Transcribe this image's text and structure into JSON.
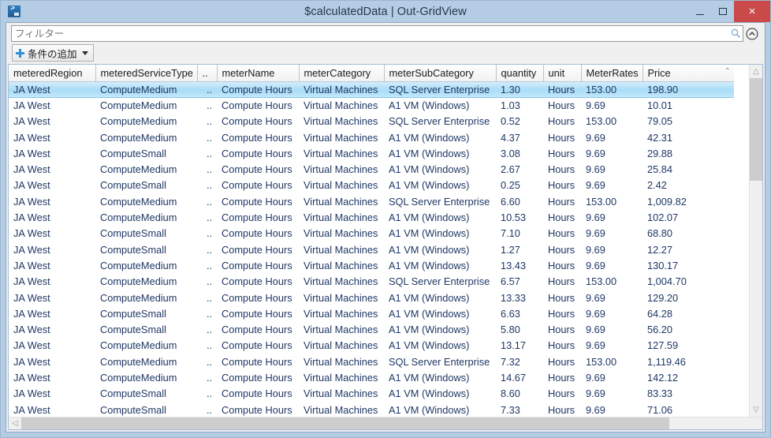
{
  "window": {
    "title": "$calculatedData | Out-GridView",
    "app_icon": "powershell-icon",
    "minimize_label": "",
    "maximize_label": "",
    "close_label": "×"
  },
  "filter": {
    "placeholder": "フィルター",
    "value": "",
    "search_icon": "search-icon",
    "expander_icon": "chevron-up-circle-icon"
  },
  "toolbar": {
    "add_criteria_label": "条件の追加",
    "add_icon": "plus-icon",
    "dropdown_icon": "chevron-down-icon"
  },
  "grid": {
    "columns": [
      "meteredRegion",
      "meteredServiceType",
      "..",
      "meterName",
      "meterCategory",
      "meterSubCategory",
      "quantity",
      "unit",
      "MeterRates",
      "Price"
    ],
    "sort_indicator": "chevron-up-icon",
    "selected_row_index": 0,
    "rows": [
      [
        "JA West",
        "ComputeMedium",
        "..",
        "Compute Hours",
        "Virtual Machines",
        "SQL Server Enterprise",
        "1.30",
        "Hours",
        "153.00",
        "198.90"
      ],
      [
        "JA West",
        "ComputeMedium",
        "..",
        "Compute Hours",
        "Virtual Machines",
        "A1 VM (Windows)",
        "1.03",
        "Hours",
        "9.69",
        "10.01"
      ],
      [
        "JA West",
        "ComputeMedium",
        "..",
        "Compute Hours",
        "Virtual Machines",
        "SQL Server Enterprise",
        "0.52",
        "Hours",
        "153.00",
        "79.05"
      ],
      [
        "JA West",
        "ComputeMedium",
        "..",
        "Compute Hours",
        "Virtual Machines",
        "A1 VM (Windows)",
        "4.37",
        "Hours",
        "9.69",
        "42.31"
      ],
      [
        "JA West",
        "ComputeSmall",
        "..",
        "Compute Hours",
        "Virtual Machines",
        "A1 VM (Windows)",
        "3.08",
        "Hours",
        "9.69",
        "29.88"
      ],
      [
        "JA West",
        "ComputeMedium",
        "..",
        "Compute Hours",
        "Virtual Machines",
        "A1 VM (Windows)",
        "2.67",
        "Hours",
        "9.69",
        "25.84"
      ],
      [
        "JA West",
        "ComputeSmall",
        "..",
        "Compute Hours",
        "Virtual Machines",
        "A1 VM (Windows)",
        "0.25",
        "Hours",
        "9.69",
        "2.42"
      ],
      [
        "JA West",
        "ComputeMedium",
        "..",
        "Compute Hours",
        "Virtual Machines",
        "SQL Server Enterprise",
        "6.60",
        "Hours",
        "153.00",
        "1,009.82"
      ],
      [
        "JA West",
        "ComputeMedium",
        "..",
        "Compute Hours",
        "Virtual Machines",
        "A1 VM (Windows)",
        "10.53",
        "Hours",
        "9.69",
        "102.07"
      ],
      [
        "JA West",
        "ComputeSmall",
        "..",
        "Compute Hours",
        "Virtual Machines",
        "A1 VM (Windows)",
        "7.10",
        "Hours",
        "9.69",
        "68.80"
      ],
      [
        "JA West",
        "ComputeSmall",
        "..",
        "Compute Hours",
        "Virtual Machines",
        "A1 VM (Windows)",
        "1.27",
        "Hours",
        "9.69",
        "12.27"
      ],
      [
        "JA West",
        "ComputeMedium",
        "..",
        "Compute Hours",
        "Virtual Machines",
        "A1 VM (Windows)",
        "13.43",
        "Hours",
        "9.69",
        "130.17"
      ],
      [
        "JA West",
        "ComputeMedium",
        "..",
        "Compute Hours",
        "Virtual Machines",
        "SQL Server Enterprise",
        "6.57",
        "Hours",
        "153.00",
        "1,004.70"
      ],
      [
        "JA West",
        "ComputeMedium",
        "..",
        "Compute Hours",
        "Virtual Machines",
        "A1 VM (Windows)",
        "13.33",
        "Hours",
        "9.69",
        "129.20"
      ],
      [
        "JA West",
        "ComputeSmall",
        "..",
        "Compute Hours",
        "Virtual Machines",
        "A1 VM (Windows)",
        "6.63",
        "Hours",
        "9.69",
        "64.28"
      ],
      [
        "JA West",
        "ComputeSmall",
        "..",
        "Compute Hours",
        "Virtual Machines",
        "A1 VM (Windows)",
        "5.80",
        "Hours",
        "9.69",
        "56.20"
      ],
      [
        "JA West",
        "ComputeMedium",
        "..",
        "Compute Hours",
        "Virtual Machines",
        "A1 VM (Windows)",
        "13.17",
        "Hours",
        "9.69",
        "127.59"
      ],
      [
        "JA West",
        "ComputeMedium",
        "..",
        "Compute Hours",
        "Virtual Machines",
        "SQL Server Enterprise",
        "7.32",
        "Hours",
        "153.00",
        "1,119.46"
      ],
      [
        "JA West",
        "ComputeMedium",
        "..",
        "Compute Hours",
        "Virtual Machines",
        "A1 VM (Windows)",
        "14.67",
        "Hours",
        "9.69",
        "142.12"
      ],
      [
        "JA West",
        "ComputeSmall",
        "..",
        "Compute Hours",
        "Virtual Machines",
        "A1 VM (Windows)",
        "8.60",
        "Hours",
        "9.69",
        "83.33"
      ],
      [
        "JA West",
        "ComputeSmall",
        "..",
        "Compute Hours",
        "Virtual Machines",
        "A1 VM (Windows)",
        "7.33",
        "Hours",
        "9.69",
        "71.06"
      ]
    ]
  },
  "scrollbars": {
    "vertical_up_icon": "chevron-up-icon",
    "vertical_down_icon": "chevron-down-icon",
    "horizontal_left_icon": "chevron-left-icon"
  },
  "colors": {
    "titlebar": "#b4cce4",
    "close_button": "#ca4a4a",
    "selection": "#a9ddf7",
    "text": "#1f3864",
    "accent": "#2f8fd8"
  }
}
